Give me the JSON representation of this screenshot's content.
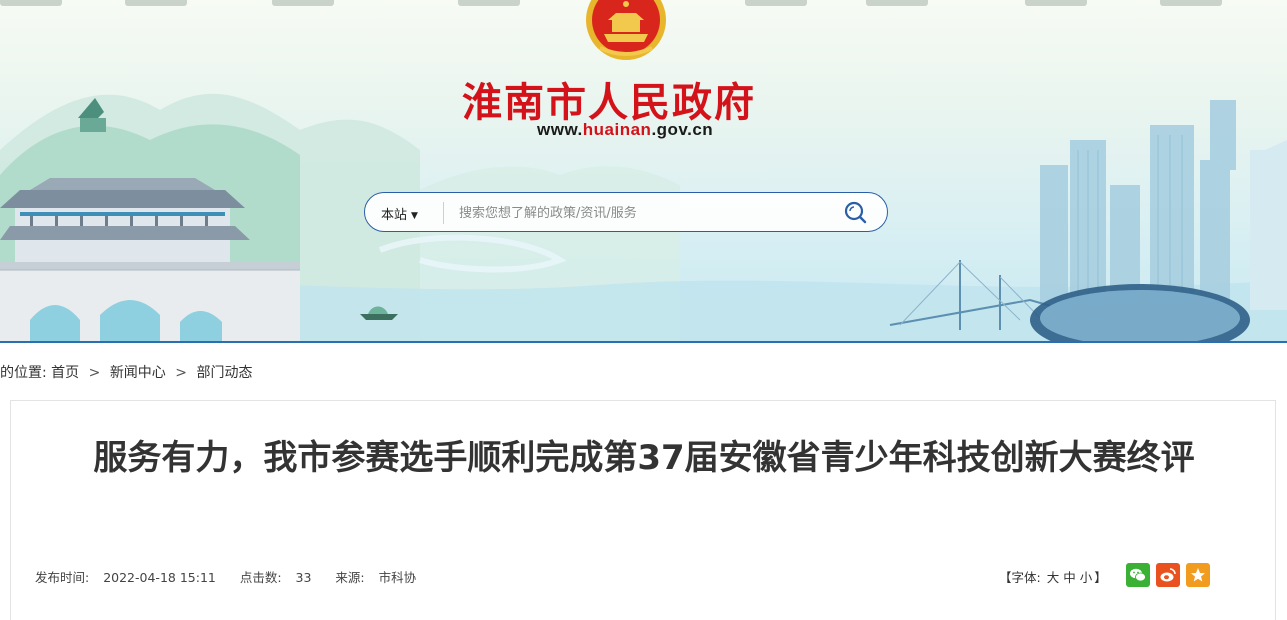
{
  "header": {
    "site_title": "淮南市人民政府",
    "url_prefix": "www.",
    "url_highlight": "huainan",
    "url_suffix": ".gov.cn",
    "colors": {
      "title_red": "#d3121a",
      "accent_blue": "#2a5fa8"
    }
  },
  "search": {
    "scope": "本站",
    "placeholder": "搜索您想了解的政策/资讯/服务",
    "icon": "search-icon"
  },
  "breadcrumb": {
    "prefix": "的位置:",
    "items": [
      "首页",
      "新闻中心",
      "部门动态"
    ],
    "separator": ">"
  },
  "article": {
    "title": "服务有力，我市参赛选手顺利完成第37届安徽省青少年科技创新大赛终评",
    "meta": {
      "publish_label": "发布时间:",
      "publish_time": "2022-04-18 15:11",
      "clicks_label": "点击数:",
      "clicks": "33",
      "source_label": "来源:",
      "source": "市科协"
    },
    "font_size": {
      "open": "【字体:",
      "large": "大",
      "medium": "中",
      "small": "小",
      "close": "】"
    },
    "share": [
      {
        "name": "wechat-share-icon",
        "color": "#3ab035"
      },
      {
        "name": "weibo-share-icon",
        "color": "#e9521f"
      },
      {
        "name": "favorite-share-icon",
        "color": "#f29c1f"
      }
    ]
  }
}
